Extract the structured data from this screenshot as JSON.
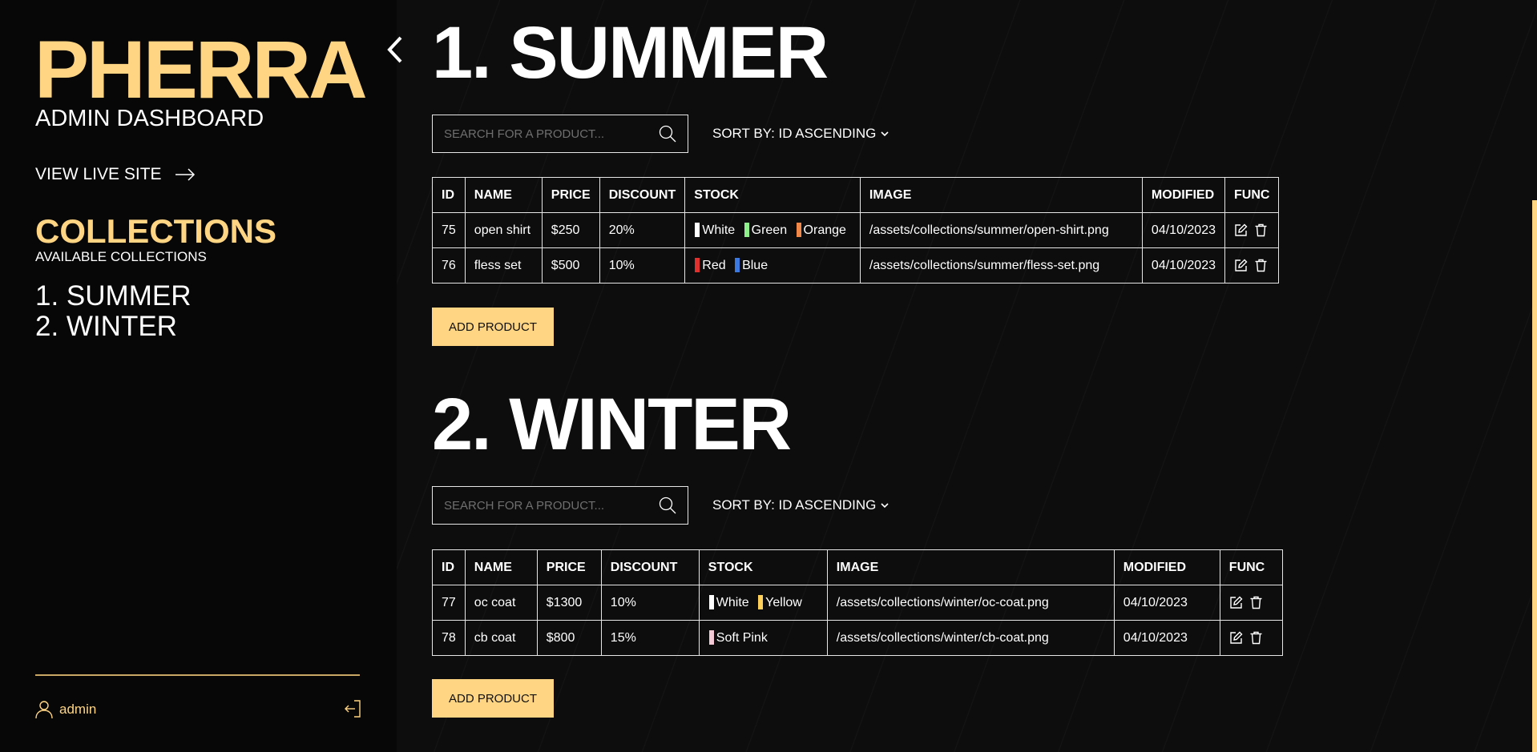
{
  "sidebar": {
    "brand": "PHERRA",
    "subtitle": "ADMIN DASHBOARD",
    "view_live_site": "VIEW LIVE SITE",
    "collections_title": "COLLECTIONS",
    "collections_subtitle": "AVAILABLE COLLECTIONS",
    "collections": [
      {
        "label": "1. SUMMER"
      },
      {
        "label": "2. WINTER"
      }
    ],
    "username": "admin"
  },
  "sections": [
    {
      "title": "1. SUMMER",
      "search_placeholder": "SEARCH FOR A PRODUCT...",
      "sort_label": "SORT BY: ID ASCENDING",
      "add_label": "ADD PRODUCT",
      "headers": [
        "ID",
        "NAME",
        "PRICE",
        "DISCOUNT",
        "STOCK",
        "IMAGE",
        "MODIFIED",
        "FUNC"
      ],
      "rows": [
        {
          "id": "75",
          "name": "open shirt",
          "price": "$250",
          "discount": "20%",
          "stock": [
            {
              "color": "White",
              "hex": "#ffffff"
            },
            {
              "color": "Green",
              "hex": "#8ef08a"
            },
            {
              "color": "Orange",
              "hex": "#f0884a"
            }
          ],
          "image": "/assets/collections/summer/open-shirt.png",
          "modified": "04/10/2023"
        },
        {
          "id": "76",
          "name": "fless set",
          "price": "$500",
          "discount": "10%",
          "stock": [
            {
              "color": "Red",
              "hex": "#e0312f"
            },
            {
              "color": "Blue",
              "hex": "#3b78e0"
            }
          ],
          "image": "/assets/collections/summer/fless-set.png",
          "modified": "04/10/2023"
        }
      ]
    },
    {
      "title": "2. WINTER",
      "search_placeholder": "SEARCH FOR A PRODUCT...",
      "sort_label": "SORT BY: ID ASCENDING",
      "add_label": "ADD PRODUCT",
      "headers": [
        "ID",
        "NAME",
        "PRICE",
        "DISCOUNT",
        "STOCK",
        "IMAGE",
        "MODIFIED",
        "FUNC"
      ],
      "rows": [
        {
          "id": "77",
          "name": "oc coat",
          "price": "$1300",
          "discount": "10%",
          "stock": [
            {
              "color": "White",
              "hex": "#ffffff"
            },
            {
              "color": "Yellow",
              "hex": "#ffd15a"
            }
          ],
          "image": "/assets/collections/winter/oc-coat.png",
          "modified": "04/10/2023"
        },
        {
          "id": "78",
          "name": "cb coat",
          "price": "$800",
          "discount": "15%",
          "stock": [
            {
              "color": "Soft Pink",
              "hex": "#f3c9d6"
            }
          ],
          "image": "/assets/collections/winter/cb-coat.png",
          "modified": "04/10/2023"
        }
      ]
    }
  ],
  "colors": {
    "accent": "#ffd584",
    "background": "#0d0d0d",
    "sidebar_bg": "#070707",
    "border": "#e6e6e6"
  },
  "icons": {
    "collapse": "chevron-left-icon",
    "live_site": "arrow-right-icon",
    "search": "search-icon",
    "sort": "chevron-down-icon",
    "edit": "edit-icon",
    "delete": "trash-icon",
    "user": "user-icon",
    "logout": "logout-icon"
  }
}
